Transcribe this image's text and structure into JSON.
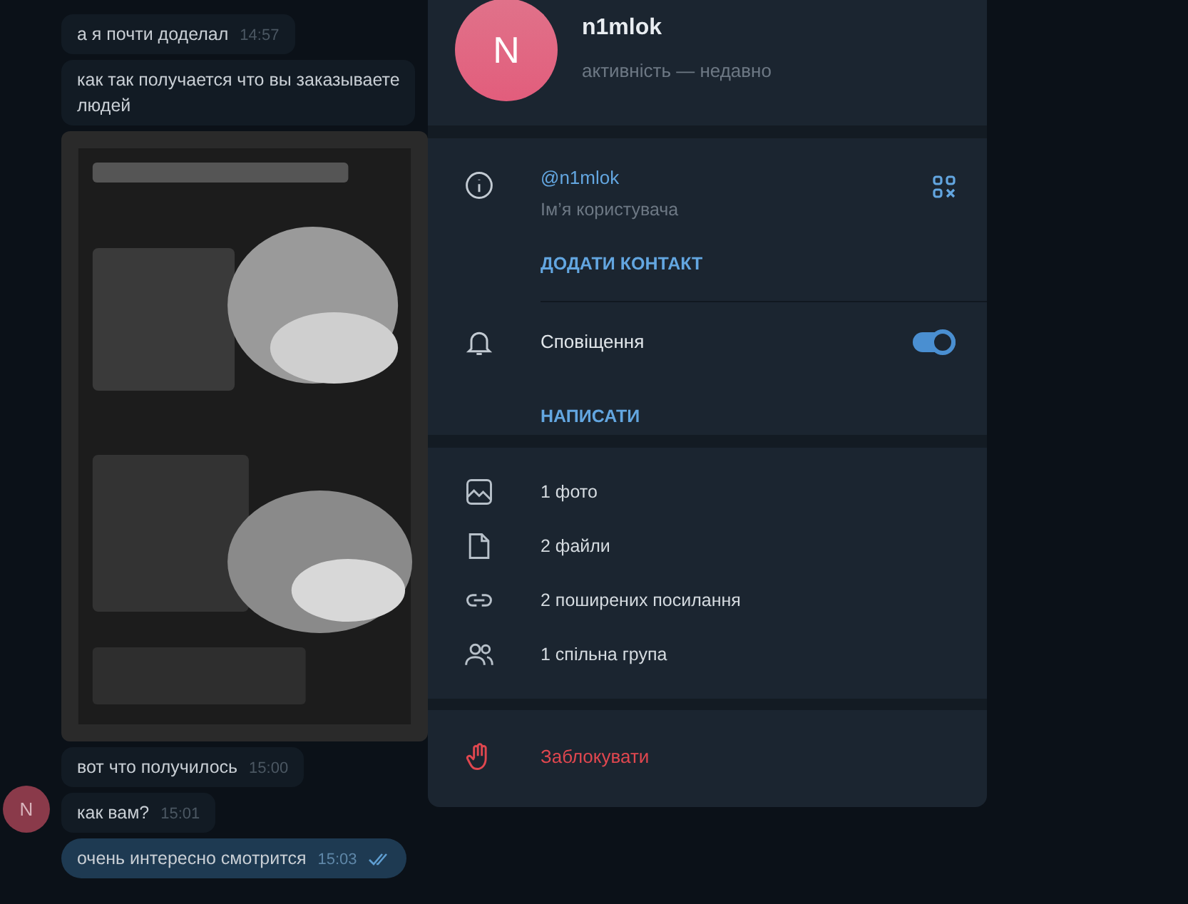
{
  "messages": [
    {
      "kind": "text",
      "text": "а я почти доделал",
      "time": "14:57",
      "outgoing": false
    },
    {
      "kind": "text",
      "text": "как так получается что вы заказываете\nлюдей",
      "outgoing": false
    },
    {
      "kind": "picture"
    },
    {
      "kind": "text",
      "text": "вот что получилось",
      "time": "15:00",
      "outgoing": false
    },
    {
      "kind": "text",
      "text": "как вам?",
      "time": "15:01",
      "outgoing": false,
      "avatar_letter": "N"
    },
    {
      "kind": "text",
      "text": "очень интересно смотрится",
      "time": "15:03",
      "outgoing": true
    }
  ],
  "profile": {
    "avatar_letter": "N",
    "name": "n1mlok",
    "status": "активність — недавно",
    "username": "@n1mlok",
    "username_label": "Ім’я користувача",
    "add_contact": "ДОДАТИ КОНТАКТ",
    "notifications": {
      "label": "Сповіщення",
      "on": true
    },
    "write": "НАПИСАТИ",
    "media": [
      {
        "label": "1 фото"
      },
      {
        "kind": "file",
        "label": "2 файли"
      },
      {
        "kind": "link",
        "label": "2 поширених посилання"
      },
      {
        "kind": "group",
        "label": "1 спільна група"
      }
    ],
    "block": "Заблокувати"
  }
}
